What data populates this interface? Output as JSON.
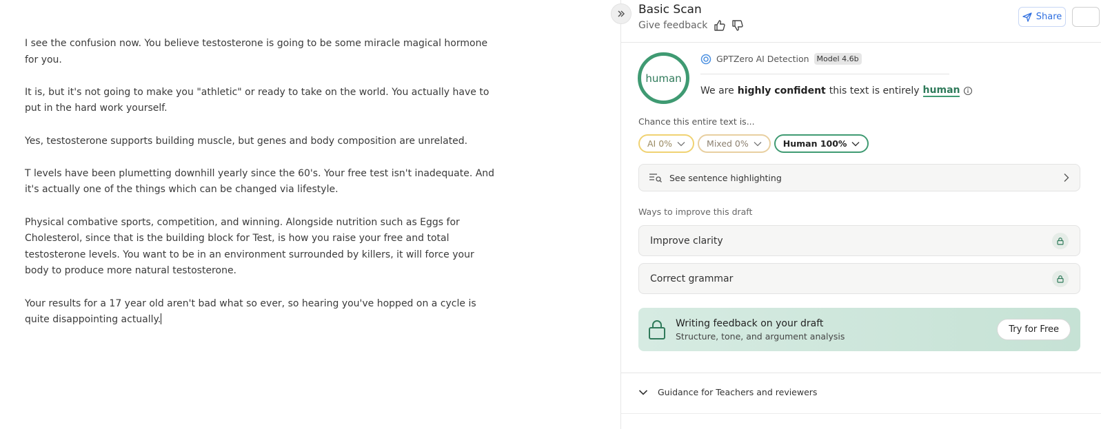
{
  "editor": {
    "paragraphs": [
      "I see the confusion now. You believe testosterone is going to be some miracle magical hormone for you.",
      "It is, but it's not going to make you \"athletic\" or ready to take on the world. You actually have to put in the hard work yourself.",
      "Yes, testosterone supports building muscle, but genes and body composition are unrelated.",
      "T levels have been plumetting downhill yearly since the 60's. Your free test isn't inadequate. And it's actually one of the things which can be changed via lifestyle.",
      "Physical combative sports, competition, and winning. Alongside nutrition such as Eggs for Cholesterol, since that is the building block for Test, is how you raise your free and total testosterone levels. You want to be in an environment surrounded by killers, it will force your body to produce more natural testosterone.",
      "Your results for a 17 year old aren't bad what so ever, so hearing you've hopped on a cycle is quite disappointing actually."
    ]
  },
  "panel": {
    "title": "Basic Scan",
    "feedback_label": "Give feedback",
    "share_label": "Share",
    "result": {
      "gauge_label": "human",
      "detector_name": "GPTZero AI Detection",
      "model_badge": "Model 4.6b",
      "confidence_prefix": "We are",
      "confidence_strong": "highly confident",
      "confidence_middle": "this text is entirely",
      "confidence_class": "human"
    },
    "chance_label": "Chance this entire text is...",
    "pills": {
      "ai": "AI 0%",
      "mixed": "Mixed 0%",
      "human": "Human 100%"
    },
    "sentence_highlighting_label": "See sentence highlighting",
    "ways_label": "Ways to improve this draft",
    "improve_items": [
      "Improve clarity",
      "Correct grammar"
    ],
    "promo": {
      "title": "Writing feedback on your draft",
      "subtitle": "Structure, tone, and argument analysis",
      "button": "Try for Free"
    },
    "guidance_label": "Guidance for Teachers and reviewers"
  },
  "colors": {
    "human_green": "#3f9a72",
    "ai_yellow": "#f0d272",
    "mixed_tan": "#e8cfa0",
    "share_blue": "#2f6fe0",
    "promo_bg": "#d6ebe2"
  },
  "icons": [
    "collapse-panel-icon",
    "thumbs-up-icon",
    "thumbs-down-icon",
    "send-icon",
    "gptzero-logo-icon",
    "info-icon",
    "chevron-down-icon",
    "text-search-icon",
    "chevron-right-icon",
    "lock-icon"
  ]
}
